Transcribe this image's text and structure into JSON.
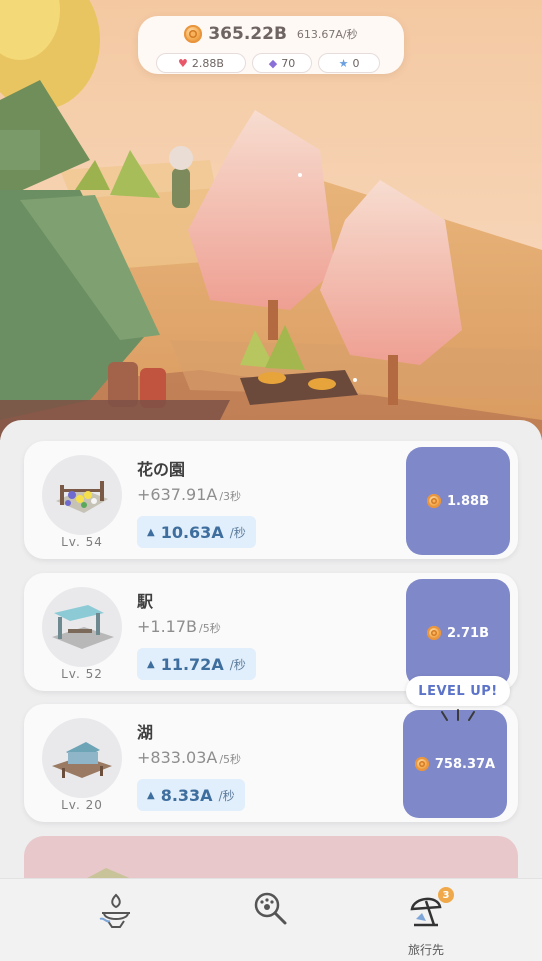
{
  "hud": {
    "coins": "365.22B",
    "coin_rate": "613.67A/秒",
    "hearts": "2.88B",
    "gems": "70",
    "stars": "0"
  },
  "facilities": [
    {
      "name": "花の園",
      "level": "Lv. 54",
      "income": "+637.91A",
      "income_interval": "/3秒",
      "boost": "10.63A",
      "boost_unit": "/秒",
      "cost": "1.88B"
    },
    {
      "name": "駅",
      "level": "Lv. 52",
      "income": "+1.17B",
      "income_interval": "/5秒",
      "boost": "11.72A",
      "boost_unit": "/秒",
      "cost": "2.71B",
      "tag": "LEVEL UP!"
    },
    {
      "name": "湖",
      "level": "Lv. 20",
      "income": "+833.03A",
      "income_interval": "/5秒",
      "boost": "8.33A",
      "boost_unit": "/秒",
      "cost": "758.37A"
    }
  ],
  "nav": {
    "items": [
      {
        "icon": "incense-icon",
        "label": ""
      },
      {
        "icon": "paw-magnifier-icon",
        "label": ""
      },
      {
        "icon": "beach-umbrella-icon",
        "label": "旅行先",
        "badge": "3"
      }
    ]
  },
  "colors": {
    "buy_button": "#7f88c9",
    "boost_bg": "#e1eefb",
    "level_up_text": "#5b73c8",
    "badge": "#f0a94a"
  }
}
